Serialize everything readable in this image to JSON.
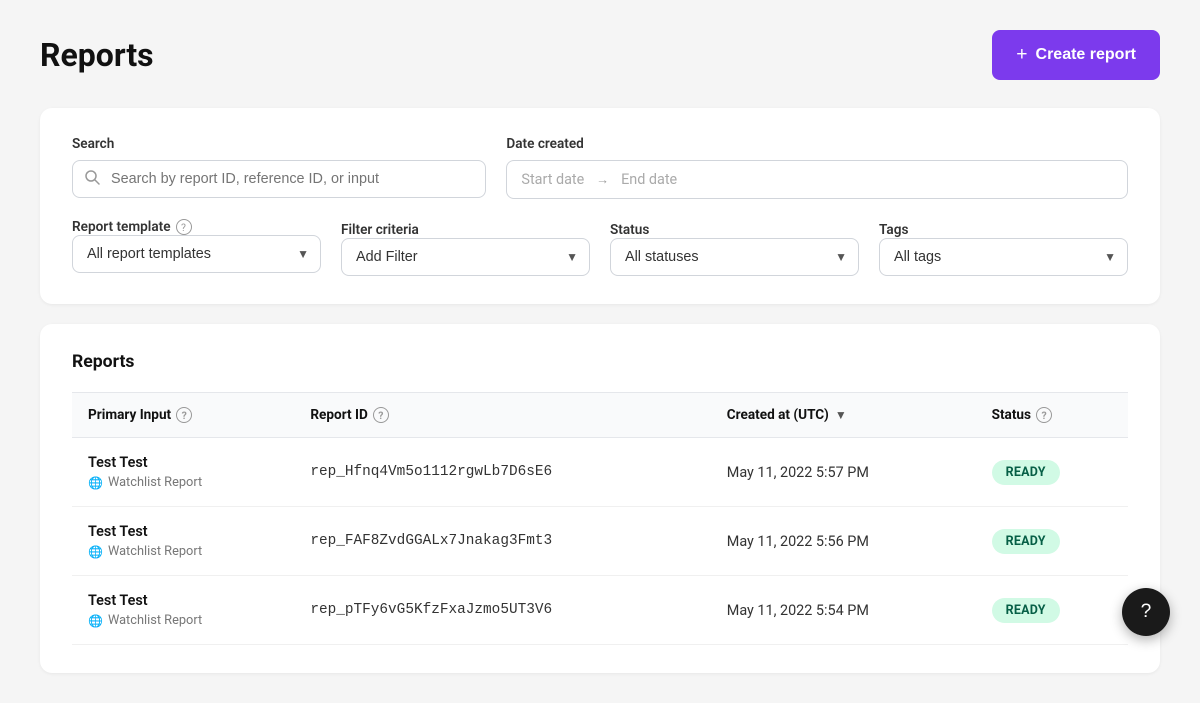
{
  "page": {
    "title": "Reports",
    "create_button_label": "Create report"
  },
  "filters": {
    "search_label": "Search",
    "search_placeholder": "Search by report ID, reference ID, or input",
    "date_label": "Date created",
    "date_start_placeholder": "Start date",
    "date_end_placeholder": "End date",
    "template_label": "Report template",
    "template_help": "?",
    "template_default": "All report templates",
    "criteria_label": "Filter criteria",
    "criteria_default": "Add Filter",
    "status_label": "Status",
    "status_default": "All statuses",
    "tags_label": "Tags",
    "tags_default": "All tags"
  },
  "reports_section": {
    "title": "Reports",
    "table": {
      "col_primary_input": "Primary Input",
      "col_report_id": "Report ID",
      "col_created_at": "Created at (UTC)",
      "col_status": "Status",
      "rows": [
        {
          "primary_input": "Test Test",
          "report_type": "Watchlist Report",
          "report_id": "rep_Hfnq4Vm5o1112rgwLb7D6sE6",
          "created_at": "May 11, 2022 5:57 PM",
          "status": "READY"
        },
        {
          "primary_input": "Test Test",
          "report_type": "Watchlist Report",
          "report_id": "rep_FAF8ZvdGGALx7Jnakag3Fmt3",
          "created_at": "May 11, 2022 5:56 PM",
          "status": "READY"
        },
        {
          "primary_input": "Test Test",
          "report_type": "Watchlist Report",
          "report_id": "rep_pTFy6vG5KfzFxaJzmo5UT3V6",
          "created_at": "May 11, 2022 5:54 PM",
          "status": "READY"
        }
      ]
    }
  },
  "fab": {
    "label": "?"
  }
}
